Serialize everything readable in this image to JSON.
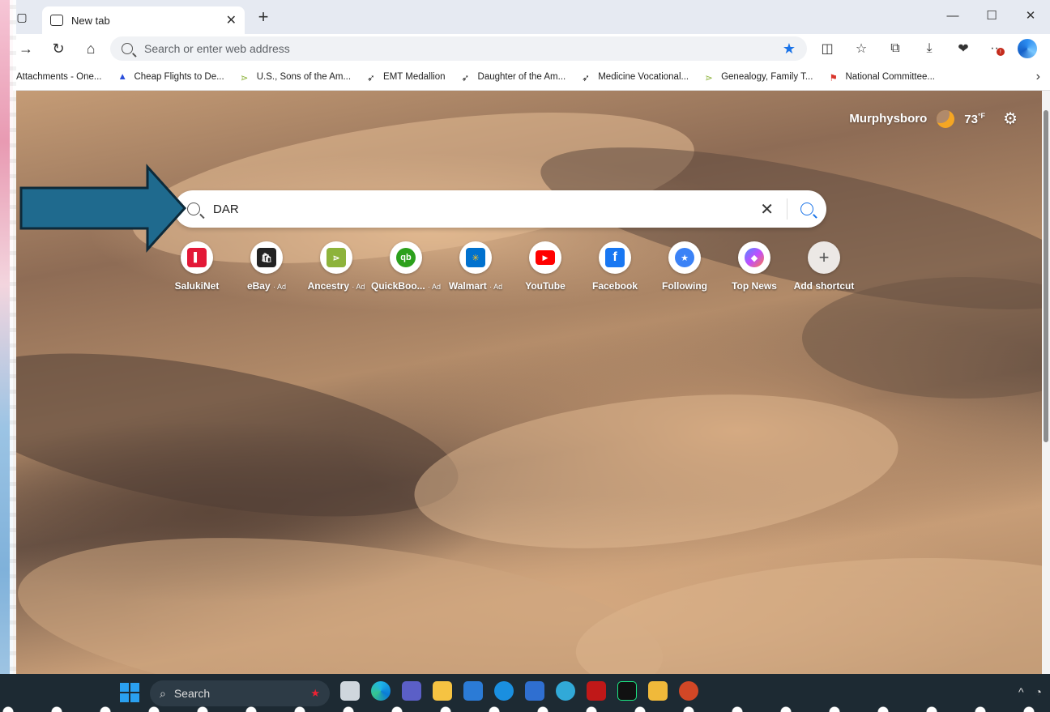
{
  "browser": {
    "tab_title": "New tab",
    "address_placeholder": "Search or enter web address"
  },
  "favorites": [
    {
      "label": "Attachments - One...",
      "color": "#1a73e8"
    },
    {
      "label": "Cheap Flights to De...",
      "color": "#2c4fdb"
    },
    {
      "label": "U.S., Sons of the Am...",
      "color": "#8db33b"
    },
    {
      "label": "EMT Medallion",
      "color": "#222222"
    },
    {
      "label": "Daughter of the Am...",
      "color": "#222222"
    },
    {
      "label": "Medicine Vocational...",
      "color": "#222222"
    },
    {
      "label": "Genealogy, Family T...",
      "color": "#8db33b"
    },
    {
      "label": "National Committee...",
      "color": "#d9352b"
    }
  ],
  "weather": {
    "location": "Murphysboro",
    "temperature": "73",
    "unit": "°F"
  },
  "search": {
    "query": "DAR"
  },
  "shortcuts": [
    {
      "label": "SalukiNet",
      "ad": "",
      "color": "#e31837",
      "glyph": "▌"
    },
    {
      "label": "eBay",
      "ad": "· Ad",
      "color": "#222222",
      "glyph": "🛍"
    },
    {
      "label": "Ancestry",
      "ad": "· Ad",
      "color": "#8db33b",
      "glyph": "⋗"
    },
    {
      "label": "QuickBoo...",
      "ad": "· Ad",
      "color": "#2ca01c",
      "glyph": "qb"
    },
    {
      "label": "Walmart",
      "ad": "· Ad",
      "color": "#0071ce",
      "glyph": "✳"
    },
    {
      "label": "YouTube",
      "ad": "",
      "color": "#ff0000",
      "glyph": "▶"
    },
    {
      "label": "Facebook",
      "ad": "",
      "color": "#1877f2",
      "glyph": "f"
    },
    {
      "label": "Following",
      "ad": "",
      "color": "#3b82f6",
      "glyph": "★"
    },
    {
      "label": "Top News",
      "ad": "",
      "color": "#7c4dff",
      "glyph": "◆"
    },
    {
      "label": "Add shortcut",
      "ad": "",
      "color": "#ffffff",
      "glyph": "+"
    }
  ],
  "taskbar": {
    "search_label": "Search"
  },
  "colors": {
    "accent": "#1a73e8",
    "arrow": "#1f6a8e",
    "taskbar": "#1d2a33"
  }
}
